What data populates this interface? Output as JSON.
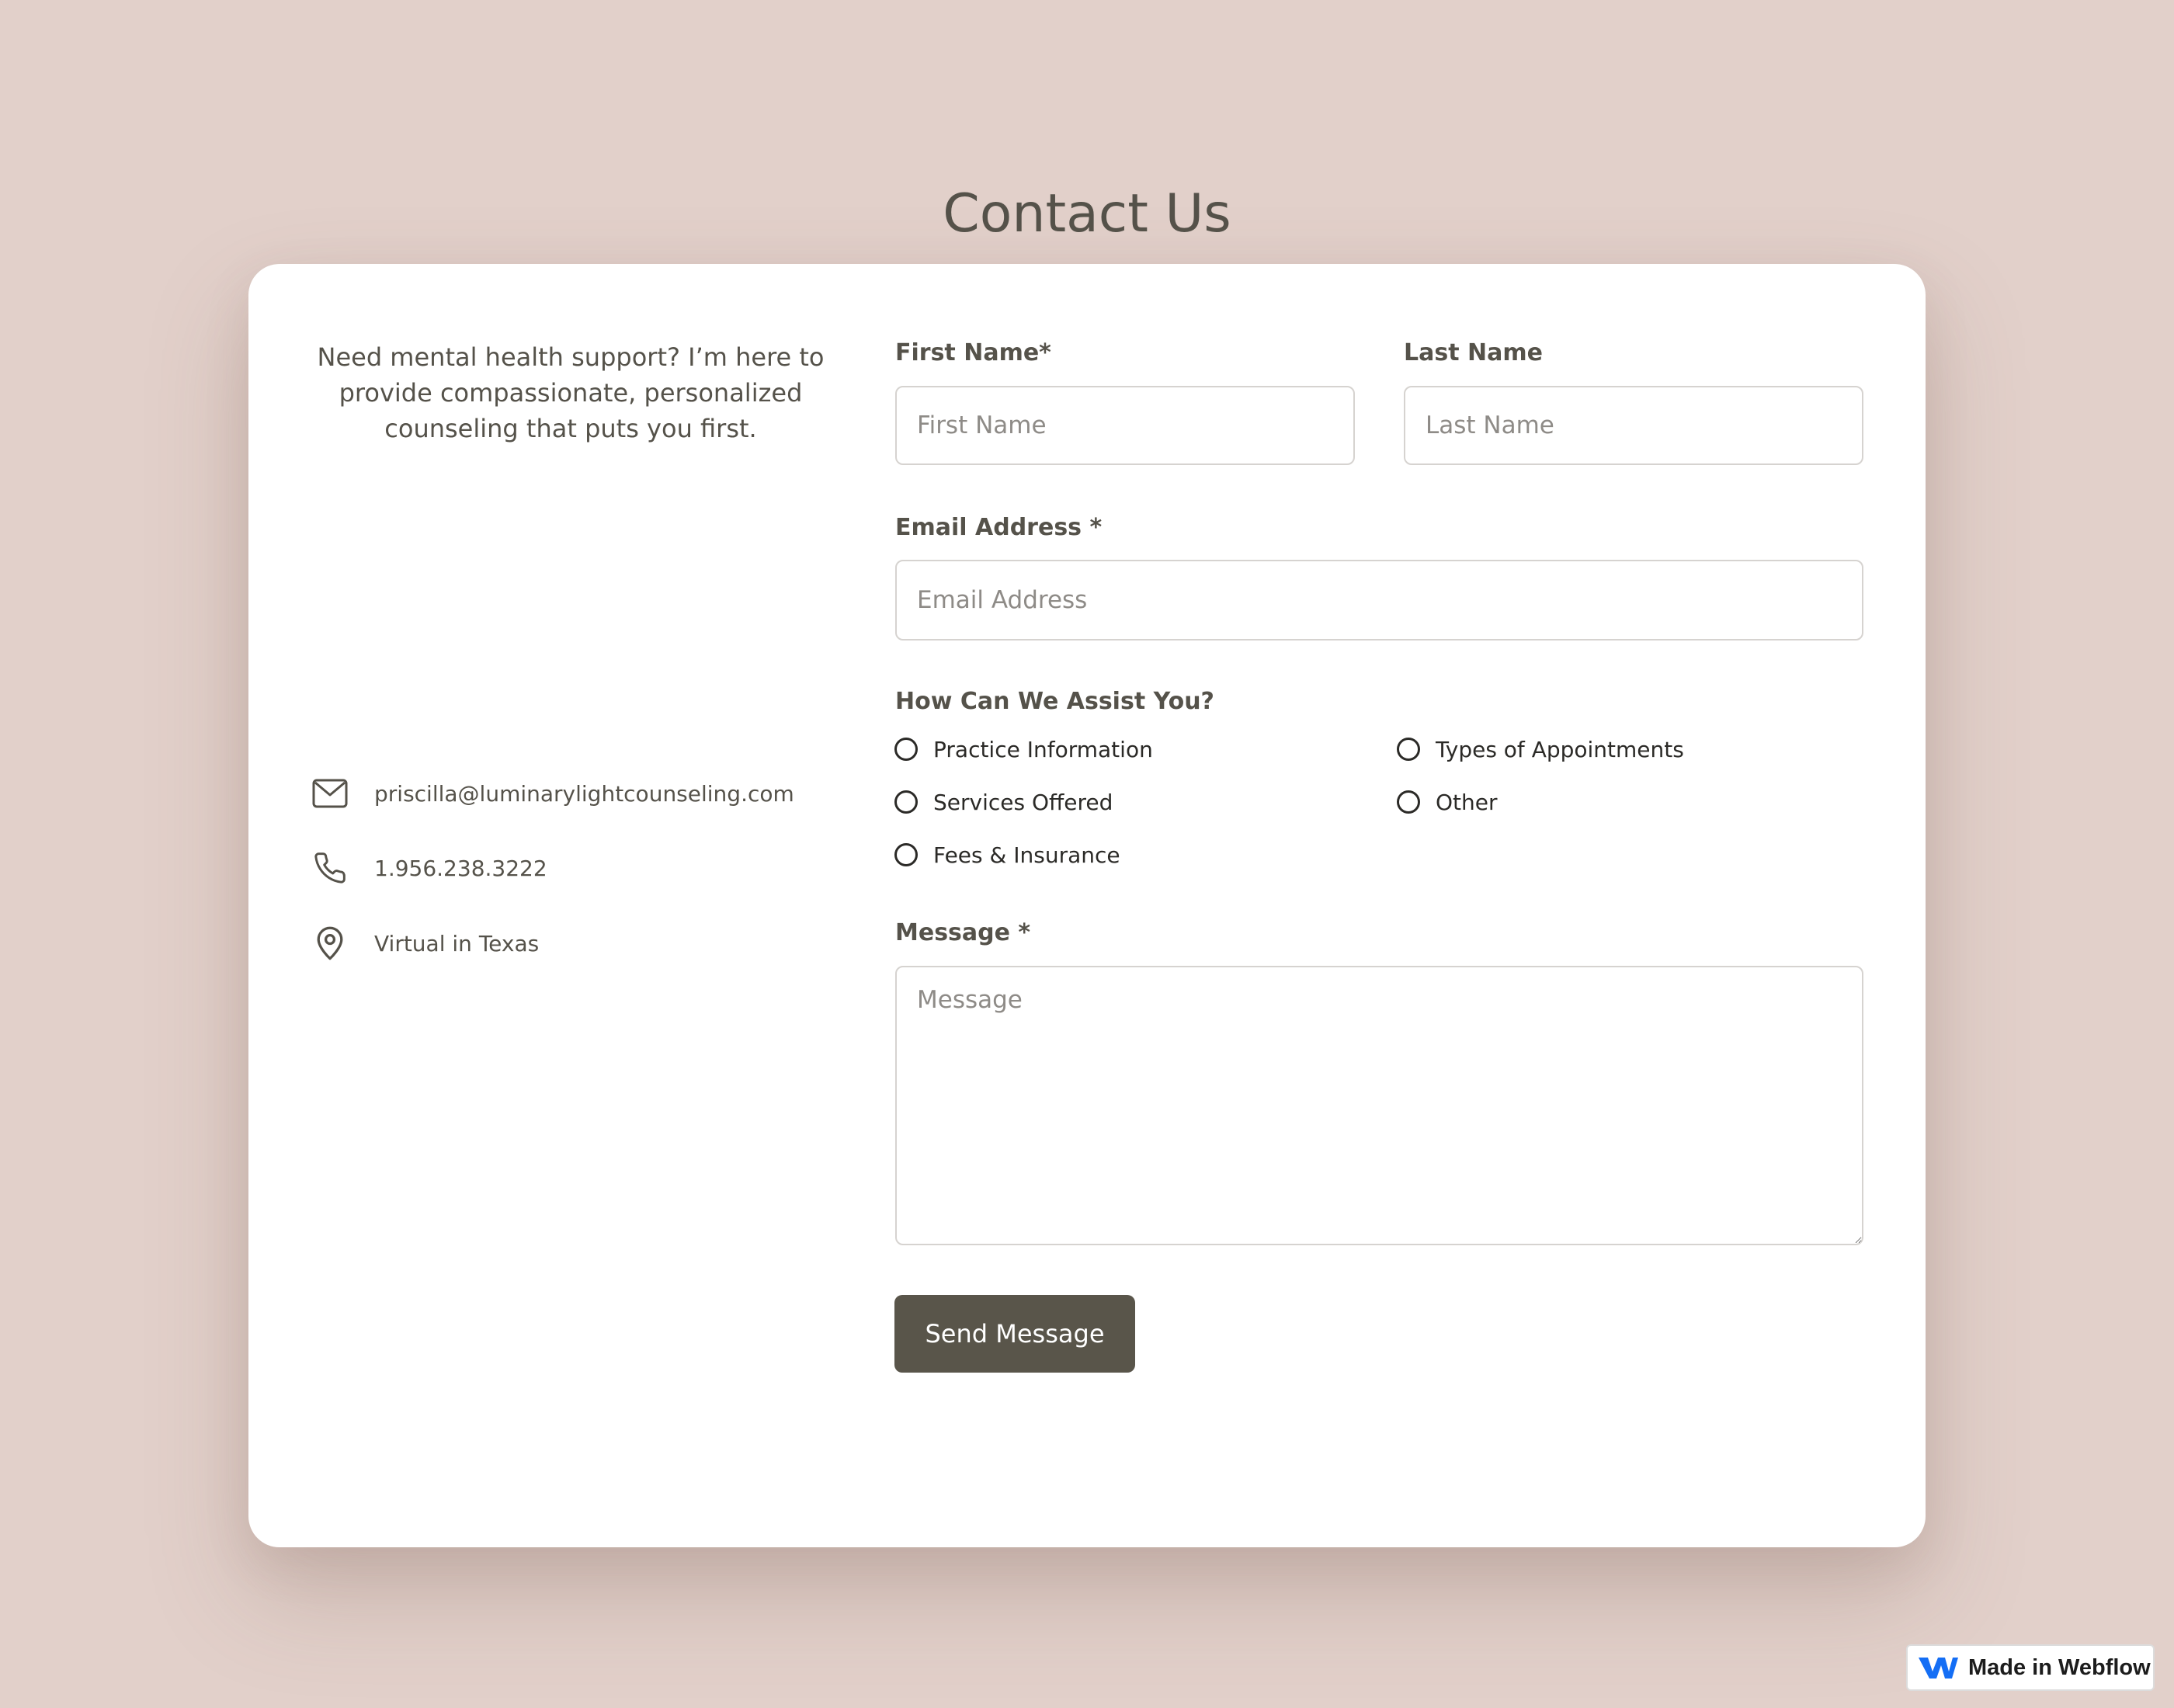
{
  "page": {
    "title": "Contact Us"
  },
  "intro": {
    "text": "Need mental health support? I’m here to provide compassionate, personalized counseling that puts you first."
  },
  "contact": {
    "email": "priscilla@luminarylightcounseling.com",
    "phone": "1.956.238.3222",
    "location": "Virtual in Texas",
    "icons": [
      "envelope-icon",
      "phone-icon",
      "map-pin-icon"
    ]
  },
  "form": {
    "first_name": {
      "label": "First Name*",
      "placeholder": "First Name",
      "value": ""
    },
    "last_name": {
      "label": "Last Name",
      "placeholder": "Last Name",
      "value": ""
    },
    "email": {
      "label": "Email Address *",
      "placeholder": "Email Address",
      "value": ""
    },
    "assist": {
      "label": "How Can We Assist You?",
      "options": [
        "Practice Information",
        "Services Offered",
        "Fees & Insurance",
        "Types of Appointments",
        "Other"
      ],
      "selected": null
    },
    "message": {
      "label": "Message *",
      "placeholder": "Message",
      "value": ""
    },
    "submit_label": "Send Message"
  },
  "badge": {
    "text": "Made in Webflow",
    "icon": "webflow-logo-icon"
  },
  "colors": {
    "background": "#e2d0ca",
    "card": "#ffffff",
    "text": "#55524a",
    "button": "#59554a",
    "webflow_blue": "#146ef5"
  }
}
